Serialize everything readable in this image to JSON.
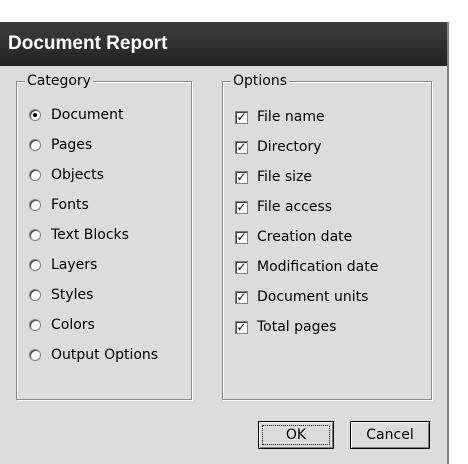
{
  "dialog": {
    "title": "Document Report"
  },
  "category": {
    "legend": "Category",
    "items": [
      {
        "label": "Document",
        "checked": true
      },
      {
        "label": "Pages",
        "checked": false
      },
      {
        "label": "Objects",
        "checked": false
      },
      {
        "label": "Fonts",
        "checked": false
      },
      {
        "label": "Text Blocks",
        "checked": false
      },
      {
        "label": "Layers",
        "checked": false
      },
      {
        "label": "Styles",
        "checked": false
      },
      {
        "label": "Colors",
        "checked": false
      },
      {
        "label": "Output Options",
        "checked": false
      }
    ]
  },
  "options": {
    "legend": "Options",
    "items": [
      {
        "label": "File name",
        "checked": true
      },
      {
        "label": "Directory",
        "checked": true
      },
      {
        "label": "File size",
        "checked": true
      },
      {
        "label": "File access",
        "checked": true
      },
      {
        "label": "Creation date",
        "checked": true
      },
      {
        "label": "Modification date",
        "checked": true
      },
      {
        "label": "Document units",
        "checked": true
      },
      {
        "label": "Total pages",
        "checked": true
      }
    ]
  },
  "buttons": {
    "ok": "OK",
    "cancel": "Cancel"
  }
}
